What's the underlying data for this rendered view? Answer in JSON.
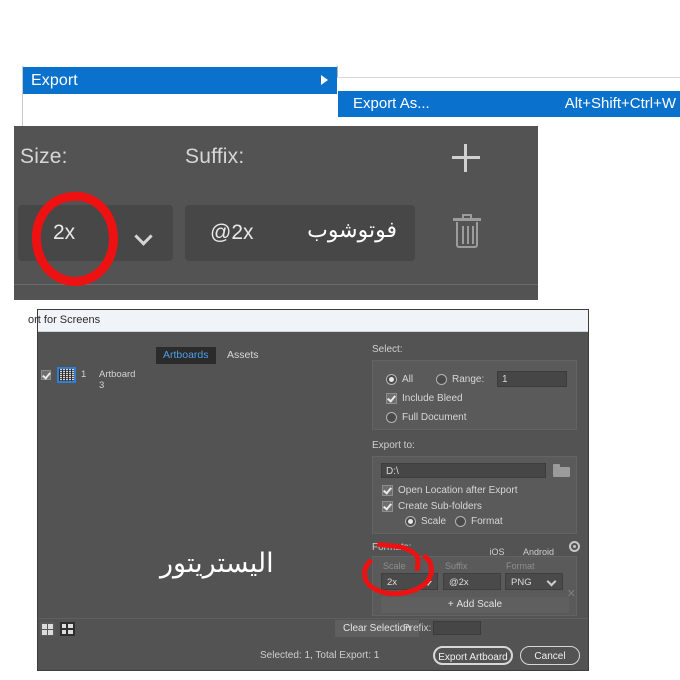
{
  "menu": {
    "export_label": "Export",
    "export_as_label": "Export As...",
    "export_as_shortcut": "Alt+Shift+Ctrl+W",
    "highlight_color": "#0a72cd"
  },
  "photoshop_panel": {
    "size_label": "Size:",
    "suffix_label": "Suffix:",
    "add_icon": "plus-icon",
    "delete_icon": "trash-icon",
    "size_value": "2x",
    "size_caret": "chevron-down-icon",
    "suffix_value": "@2x",
    "annotation_text": "فوتوشوب",
    "panel_bg": "#535353",
    "field_bg": "#474747",
    "annotation_color": "#ee1111"
  },
  "illustrator_dialog": {
    "title": "ort for Screens",
    "watermark": "اليستريتور",
    "tabs": [
      {
        "label": "Artboards",
        "active": true
      },
      {
        "label": "Assets",
        "active": false
      }
    ],
    "artboard": {
      "checked": true,
      "number": "1",
      "name": "Artboard 3"
    },
    "select": {
      "label": "Select:",
      "all_label": "All",
      "all_selected": true,
      "range_label": "Range:",
      "range_selected": false,
      "range_value": "1",
      "include_bleed_label": "Include Bleed",
      "include_bleed_checked": true,
      "full_document_label": "Full Document",
      "full_document_selected": false
    },
    "export_to": {
      "label": "Export to:",
      "path_value": "D:\\",
      "folder_icon": "folder-icon",
      "open_location_label": "Open Location after Export",
      "open_location_checked": true,
      "create_subfolders_label": "Create Sub-folders",
      "create_subfolders_checked": true,
      "scale_label": "Scale",
      "scale_selected": true,
      "format_label": "Format",
      "format_selected": false
    },
    "formats": {
      "label": "Formats:",
      "platform_ios": "iOS",
      "platform_android": "Android",
      "settings_icon": "gear-icon",
      "col_scale": "Scale",
      "col_suffix": "Suffix",
      "col_format": "Format",
      "scale_value": "2x",
      "suffix_value": "@2x",
      "format_value": "PNG",
      "remove_icon": "close-icon",
      "add_scale_label": "Add Scale"
    },
    "bottom": {
      "view_grid_icon": "grid-view-icon",
      "view_list_icon": "list-view-icon",
      "clear_selection_label": "Clear Selection",
      "prefix_label": "Prefix:",
      "prefix_value": "",
      "status": "Selected: 1, Total Export: 1",
      "export_artboard_label": "Export Artboard",
      "cancel_label": "Cancel"
    },
    "dialog_bg": "#535353",
    "titlebar_bg": "#f0f4f8",
    "accent_color": "#4f9ee8"
  }
}
